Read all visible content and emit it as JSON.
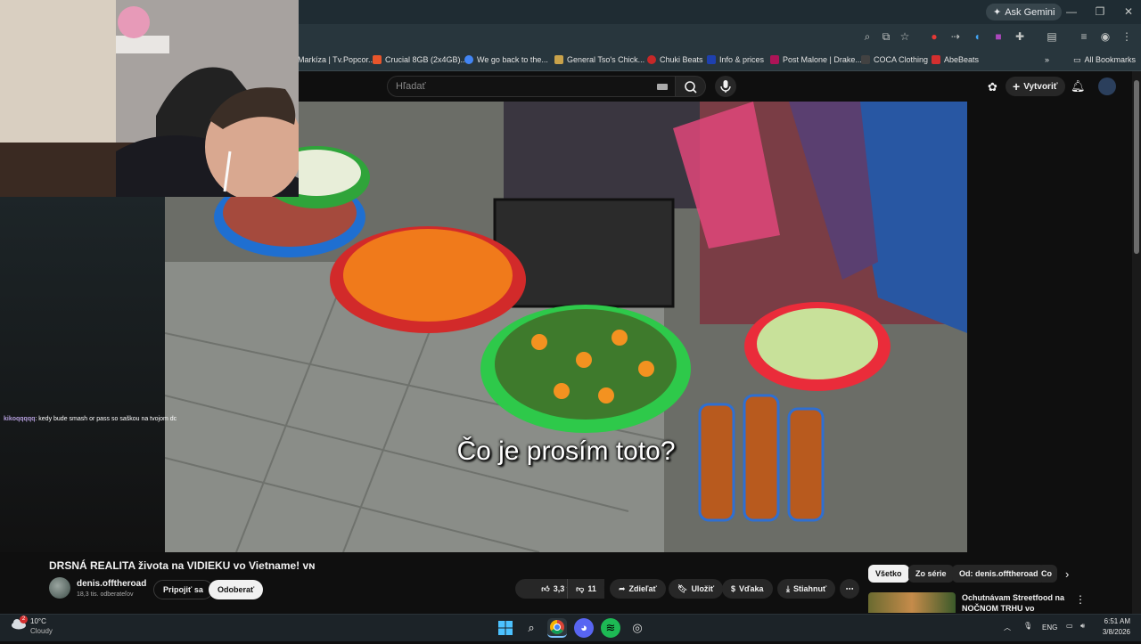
{
  "browser": {
    "ask_gemini": "Ask Gemini",
    "bookmarks": [
      {
        "label": "Markíza | Tv.Popcor...",
        "color": "#3a7bd5"
      },
      {
        "label": "Crucial 8GB (2x4GB)...",
        "color": "#e8552b"
      },
      {
        "label": "We go back to the...",
        "color": "#4285f4"
      },
      {
        "label": "General Tso's Chick...",
        "color": "#c9a24a"
      },
      {
        "label": "Chuki Beats",
        "color": "#c62828"
      },
      {
        "label": "Info & prices",
        "color": "#1e40af"
      },
      {
        "label": "Post Malone | Drake...",
        "color": "#ad1457"
      },
      {
        "label": "COCA Clothing",
        "color": "#424242"
      },
      {
        "label": "AbeBeats",
        "color": "#d32f2f"
      }
    ],
    "all_bookmarks": "All Bookmarks"
  },
  "youtube": {
    "search_placeholder": "Hľadať",
    "create_label": "Vytvoriť",
    "video_caption": "Čo je prosím toto?",
    "video_title": "DRSNÁ REALITA života na VIDIEKU vo Vietname! ᴠɴ",
    "channel_name": "denis.offtheroad",
    "subscribers": "18,3 tis. odberateľov",
    "join_label": "Pripojiť sa",
    "subscribe_label": "Odoberať",
    "likes": "3,3 tis.",
    "dislikes": "11",
    "share_label": "Zdieľať",
    "save_label": "Uložiť",
    "thanks_label": "Vďaka",
    "download_label": "Stiahnuť",
    "chips": [
      "Všetko",
      "Zo série",
      "Od: denis.offtheroad",
      "Co"
    ],
    "recommended_title": "Ochutnávam Streetfood na NOČNOM TRHU vo Vietname! ..."
  },
  "stream_chat": {
    "user": "kikoqqqqq",
    "message": ": kedy bude smash or pass so saškou na tvojom dc"
  },
  "taskbar": {
    "temperature": "10°C",
    "weather": "Cloudy",
    "weather_badge": "2",
    "language": "ENG",
    "time": "6:51 AM",
    "date": "3/8/2026"
  }
}
